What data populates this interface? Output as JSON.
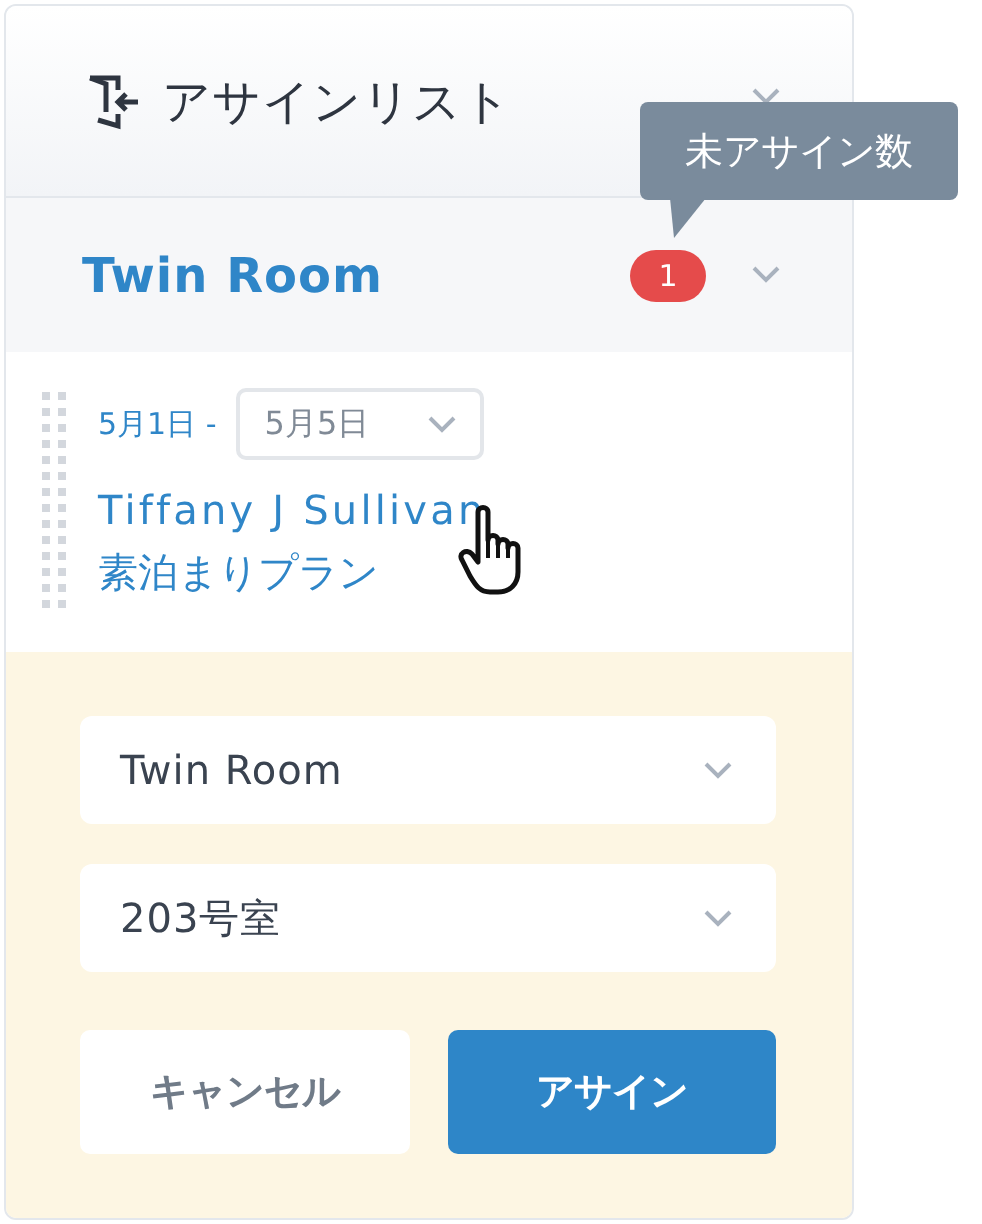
{
  "header": {
    "title": "アサインリスト"
  },
  "tooltip": {
    "text": "未アサイン数"
  },
  "room_group": {
    "title": "Twin Room",
    "badge": "1"
  },
  "booking": {
    "start": "5月1日 -",
    "end": "5月5日",
    "guest": "Tiffany J Sullivan",
    "plan": "素泊まりプラン"
  },
  "form": {
    "room_type": "Twin Room",
    "room_number": "203号室",
    "buttons": [
      {
        "label": "キャンセル",
        "kind": "secondary"
      },
      {
        "label": "アサイン",
        "kind": "primary"
      }
    ]
  }
}
